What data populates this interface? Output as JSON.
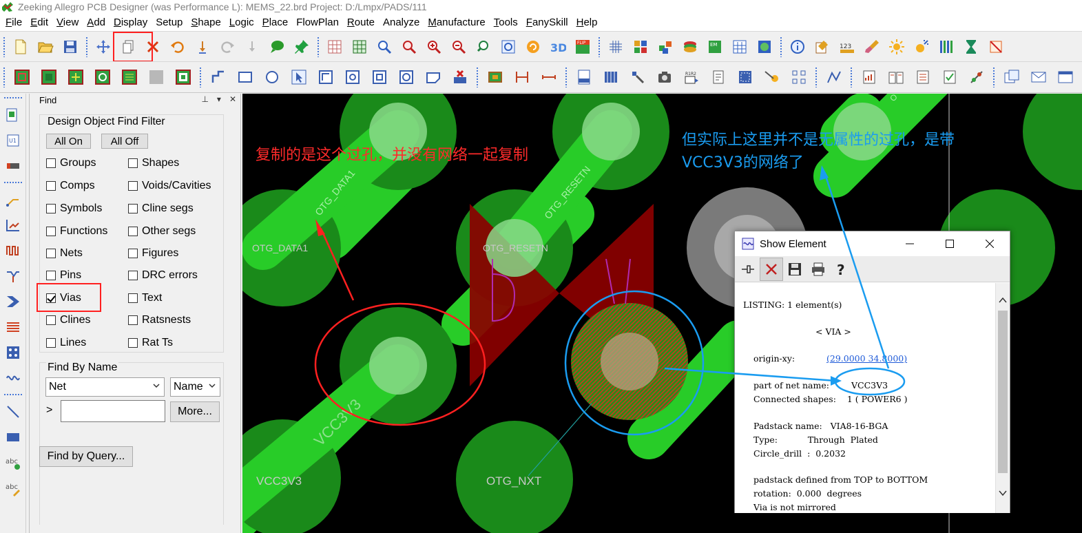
{
  "window": {
    "title": "Zeeking Allegro PCB Designer (was Performance L): MEMS_22.brd  Project: D:/Lmpx/PADS/111"
  },
  "menu": [
    {
      "label": "File",
      "u": "F",
      "rest": "ile"
    },
    {
      "label": "Edit",
      "u": "E",
      "rest": "dit"
    },
    {
      "label": "View",
      "u": "V",
      "rest": "iew"
    },
    {
      "label": "Add",
      "u": "A",
      "rest": "dd"
    },
    {
      "label": "Display",
      "u": "D",
      "rest": "isplay"
    },
    {
      "label": "Setup",
      "u": "",
      "rest": "Setup"
    },
    {
      "label": "Shape",
      "u": "S",
      "rest": "hape"
    },
    {
      "label": "Logic",
      "u": "L",
      "rest": "ogic"
    },
    {
      "label": "Place",
      "u": "P",
      "rest": "lace"
    },
    {
      "label": "FlowPlan",
      "u": "",
      "rest": "FlowPlan"
    },
    {
      "label": "Route",
      "u": "R",
      "rest": "oute"
    },
    {
      "label": "Analyze",
      "u": "",
      "rest": "Analyze"
    },
    {
      "label": "Manufacture",
      "u": "M",
      "rest": "anufacture"
    },
    {
      "label": "Tools",
      "u": "T",
      "rest": "ools"
    },
    {
      "label": "FanySkill",
      "u": "F",
      "rest": "anySkill"
    },
    {
      "label": "Help",
      "u": "H",
      "rest": "elp"
    }
  ],
  "find_panel": {
    "title": "Find",
    "filter_title": "Design Object Find Filter",
    "all_on": "All On",
    "all_off": "All Off",
    "checks": {
      "groups": {
        "label": "Groups",
        "checked": false
      },
      "shapes": {
        "label": "Shapes",
        "checked": false
      },
      "comps": {
        "label": "Comps",
        "checked": false
      },
      "voids": {
        "label": "Voids/Cavities",
        "checked": false
      },
      "symbols": {
        "label": "Symbols",
        "checked": false
      },
      "cline_segs": {
        "label": "Cline segs",
        "checked": false
      },
      "functions": {
        "label": "Functions",
        "checked": false
      },
      "other_segs": {
        "label": "Other segs",
        "checked": false
      },
      "nets": {
        "label": "Nets",
        "checked": false
      },
      "figures": {
        "label": "Figures",
        "checked": false
      },
      "pins": {
        "label": "Pins",
        "checked": false
      },
      "drc_errors": {
        "label": "DRC errors",
        "checked": false
      },
      "vias": {
        "label": "Vias",
        "checked": true
      },
      "text": {
        "label": "Text",
        "checked": false
      },
      "clines": {
        "label": "Clines",
        "checked": false
      },
      "ratsnests": {
        "label": "Ratsnests",
        "checked": false
      },
      "lines": {
        "label": "Lines",
        "checked": false
      },
      "rat_ts": {
        "label": "Rat Ts",
        "checked": false
      }
    },
    "find_by_name": "Find By Name",
    "type_select": "Net",
    "mode_select": "Name",
    "prompt": ">",
    "name_value": "",
    "more": "More...",
    "query": "Find by Query..."
  },
  "canvas": {
    "labels": {
      "otg_data1_vert": "OTG_DATA1",
      "otg_resetn_vert": "OTG_RESETN",
      "otg_data1": "OTG_DATA1",
      "otg_resetn": "OTG_RESETN",
      "vcc3v3_diag": "VCC3V3",
      "vcc3v3": "VCC3V3",
      "otg_nxt": "OTG_NXT",
      "p_mark": "P",
      "top_fragment": "O"
    }
  },
  "annotations": {
    "red": "复制的是这个过孔，并没有网络一起复制",
    "blue_line1": "但实际上这里并不是无属性的过孔，是带",
    "blue_line2": "VCC3V3的网络了"
  },
  "show_element": {
    "title": "Show Element",
    "lines": {
      "listing": "LISTING: 1 element(s)",
      "via": "< VIA >",
      "origin_label": "origin-xy:",
      "origin_value": "(29.0000 34.8000)",
      "net_label": "part of net name:",
      "net_value": "VCC3V3",
      "shapes": "Connected shapes:    1 ( POWER6 )",
      "padstack": "Padstack name:   VIA8-16-BGA",
      "type": "Type:           Through  Plated",
      "drill": "Circle_drill  :  0.2032",
      "defined": "padstack defined from TOP to BOTTOM",
      "rotation": "rotation:  0.000  degrees",
      "mirror": "Via is not mirrored"
    }
  },
  "colors": {
    "pad_dark": "#1a8a1a",
    "pad_bright": "#28cc28",
    "pad_center": "#8ad88a",
    "grey_pad": "#7a7a7a",
    "shape_red": "#8b0000",
    "annotation_red": "#ff2a2a",
    "annotation_blue": "#1a9cf0"
  }
}
